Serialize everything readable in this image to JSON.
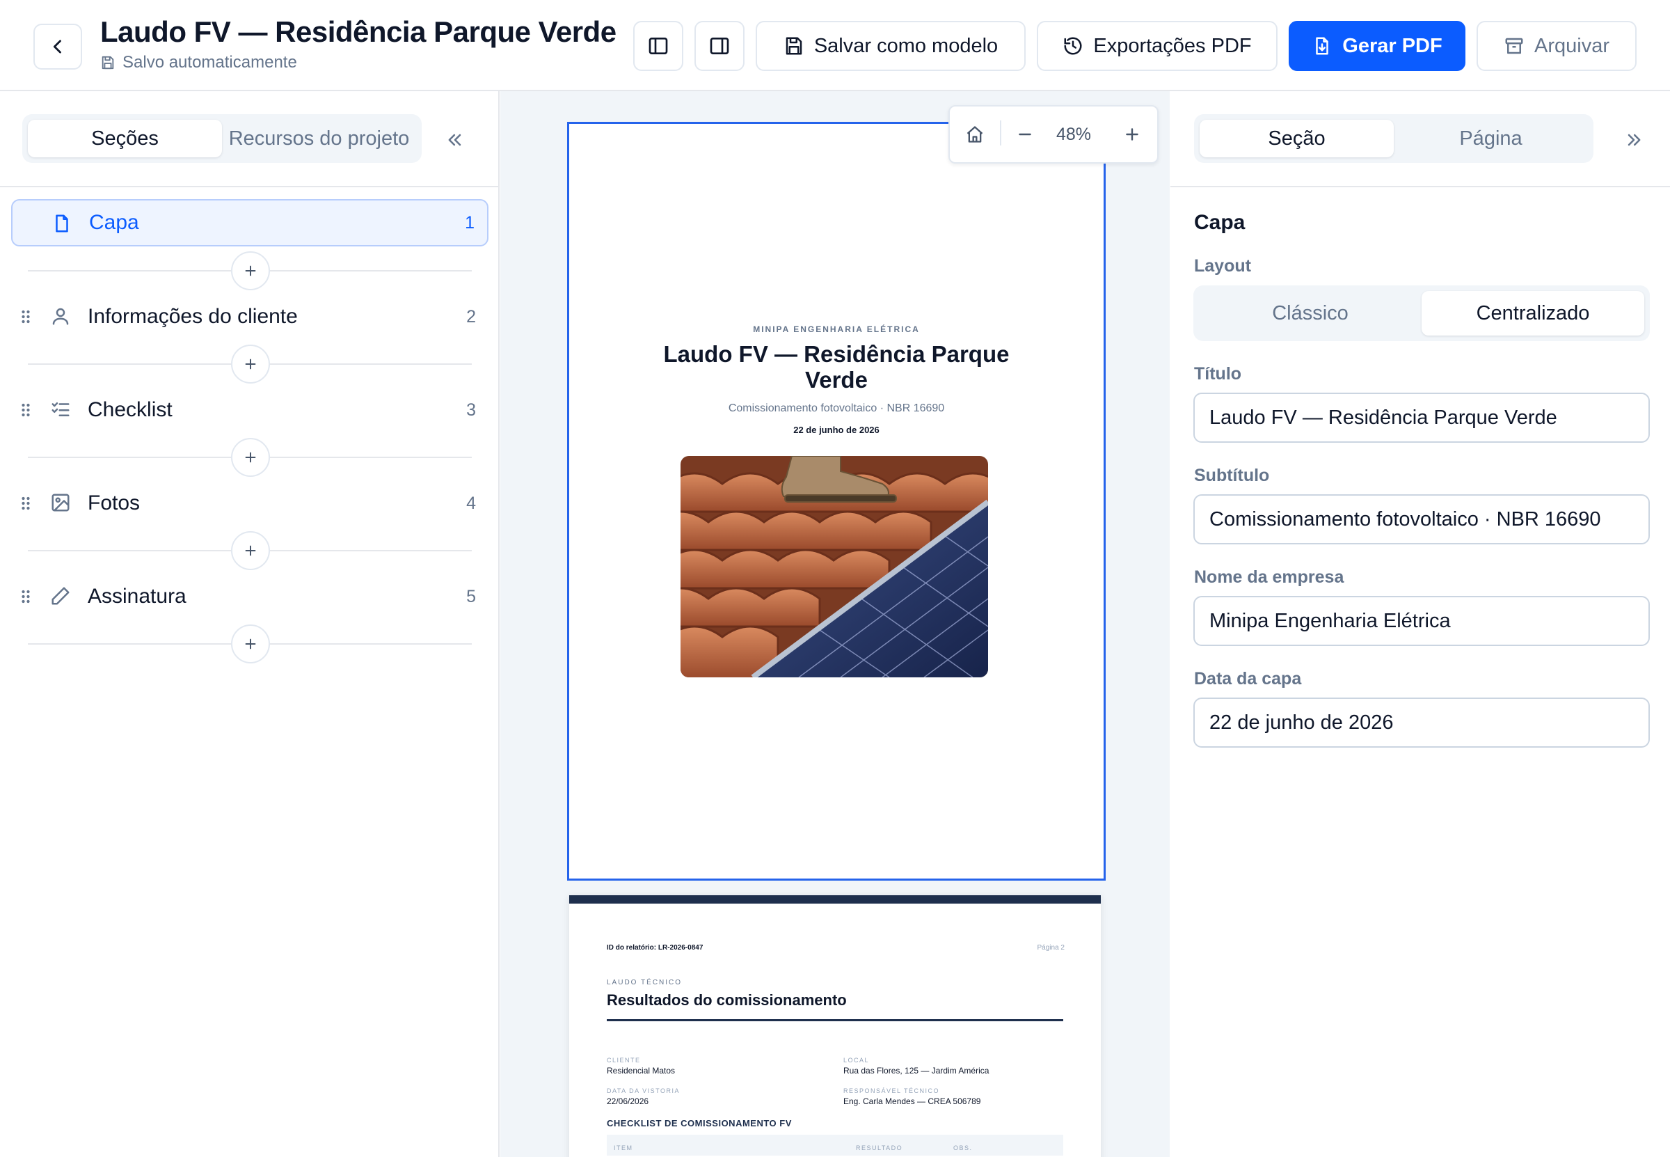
{
  "header": {
    "title": "Laudo FV — Residência Parque Verde",
    "autosave": "Salvo automaticamente",
    "save_template": "Salvar como modelo",
    "exports": "Exportações PDF",
    "generate": "Gerar PDF",
    "archive": "Arquivar"
  },
  "left": {
    "tabs": [
      "Seções",
      "Recursos do projeto"
    ],
    "sections": [
      {
        "label": "Capa",
        "num": "1",
        "icon": "file-icon"
      },
      {
        "label": "Informações do cliente",
        "num": "2",
        "icon": "user-icon"
      },
      {
        "label": "Checklist",
        "num": "3",
        "icon": "checklist-icon"
      },
      {
        "label": "Fotos",
        "num": "4",
        "icon": "image-icon"
      },
      {
        "label": "Assinatura",
        "num": "5",
        "icon": "pencil-icon"
      }
    ]
  },
  "canvas": {
    "zoom": "48%",
    "page1": {
      "company": "MINIPA ENGENHARIA ELÉTRICA",
      "title": "Laudo FV — Residência Parque Verde",
      "subtitle": "Comissionamento fotovoltaico · NBR 16690",
      "date": "22 de junho de 2026"
    },
    "page2": {
      "report_id": "ID do relatório: LR-2026-0847",
      "page": "Página 2",
      "kicker": "LAUDO TÉCNICO",
      "heading": "Resultados do comissionamento",
      "client_label": "CLIENTE",
      "client": "Residencial Matos",
      "location_label": "LOCAL",
      "location": "Rua das Flores, 125 — Jardim América",
      "date_label": "DATA DA VISTORIA",
      "date": "22/06/2026",
      "tech_label": "RESPONSÁVEL TÉCNICO",
      "tech": "Eng. Carla Mendes — CREA 506789",
      "checklist_title": "CHECKLIST DE COMISSIONAMENTO FV",
      "col_item": "ITEM",
      "col_result": "RESULTADO",
      "col_obs": "OBS."
    }
  },
  "right": {
    "tabs": [
      "Seção",
      "Página"
    ],
    "section_title": "Capa",
    "layout_label": "Layout",
    "layout_options": [
      "Clássico",
      "Centralizado"
    ],
    "fields": {
      "title_label": "Título",
      "title_value": "Laudo FV — Residência Parque Verde",
      "subtitle_label": "Subtítulo",
      "subtitle_value": "Comissionamento fotovoltaico · NBR 16690",
      "company_label": "Nome da empresa",
      "company_value": "Minipa Engenharia Elétrica",
      "date_label": "Data da capa",
      "date_value": "22 de junho de 2026"
    }
  },
  "colors": {
    "accent": "#0b5cff",
    "navy": "#1e2f4d",
    "text": "#0f172a",
    "muted": "#64748b"
  }
}
